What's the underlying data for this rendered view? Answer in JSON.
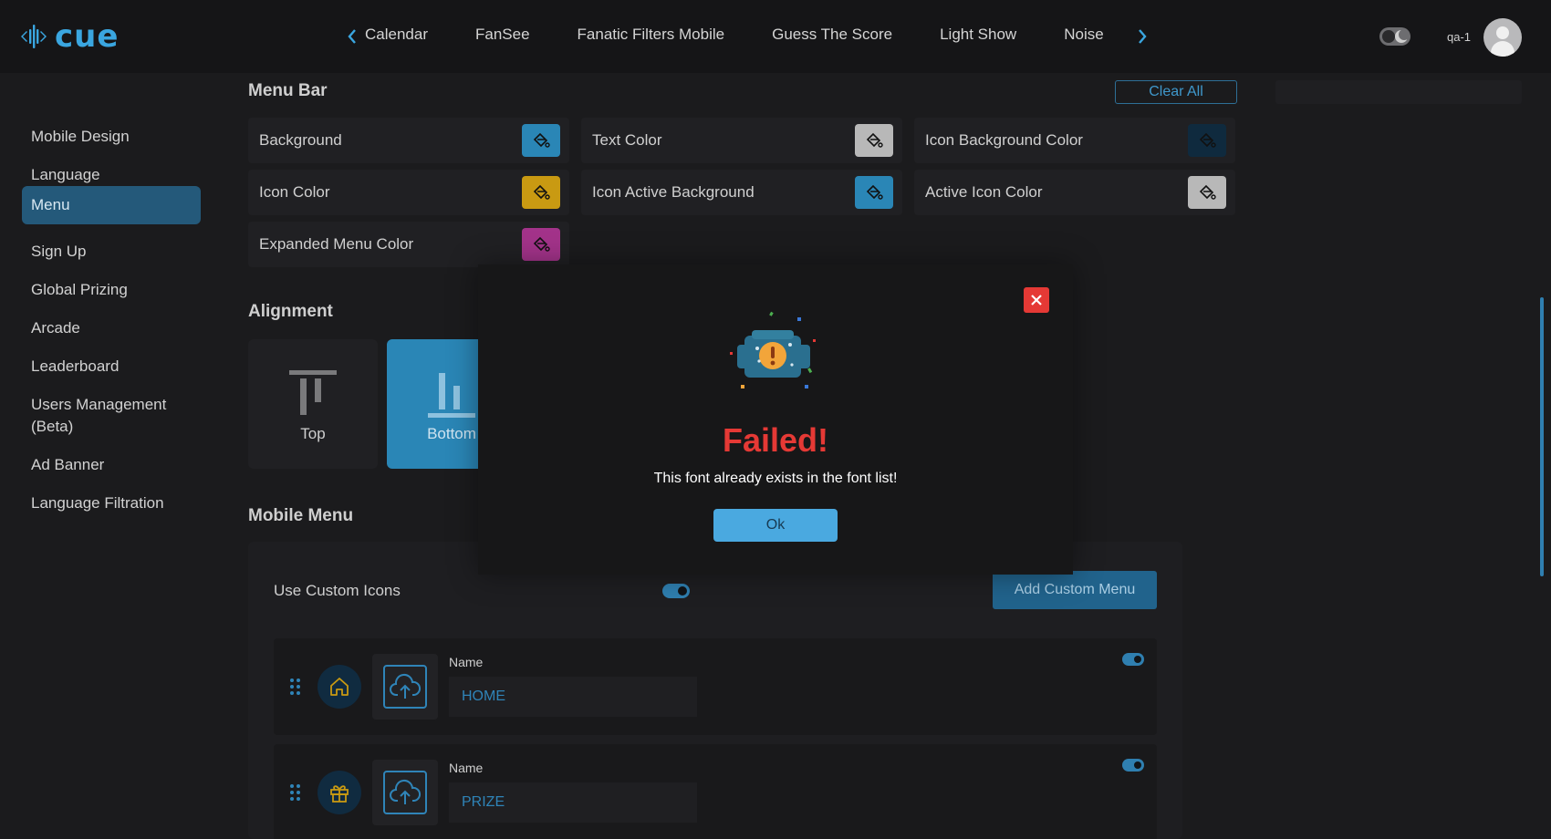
{
  "header": {
    "logo_text": "cue",
    "tabs": [
      "Calendar",
      "FanSee",
      "Fanatic Filters Mobile",
      "Guess The Score",
      "Light Show",
      "Noise"
    ],
    "username": "qa-1"
  },
  "sidebar": {
    "items": [
      {
        "label": "Mobile Design"
      },
      {
        "label": "Language"
      },
      {
        "label": "Menu",
        "active": true
      },
      {
        "label": "Sign Up"
      },
      {
        "label": "Global Prizing"
      },
      {
        "label": "Arcade"
      },
      {
        "label": "Leaderboard"
      },
      {
        "label": "Users Management (Beta)"
      },
      {
        "label": "Ad Banner"
      },
      {
        "label": "Language Filtration"
      }
    ]
  },
  "menu_bar": {
    "title": "Menu Bar",
    "clear_all": "Clear All",
    "colors": [
      {
        "label": "Background",
        "color": "#2a86b6"
      },
      {
        "label": "Text Color",
        "color": "#b8b8b8"
      },
      {
        "label": "Icon Background Color",
        "color": "#0f2a3e"
      },
      {
        "label": "Icon Color",
        "color": "#c99a12"
      },
      {
        "label": "Icon Active Background",
        "color": "#2a86b6"
      },
      {
        "label": "Active Icon Color",
        "color": "#b8b8b8"
      },
      {
        "label": "Expanded Menu Color",
        "color": "#a3338a"
      }
    ]
  },
  "alignment": {
    "title": "Alignment",
    "options": [
      "Top",
      "Bottom"
    ],
    "selected": "Bottom"
  },
  "mobile_menu": {
    "title": "Mobile Menu",
    "use_custom_icons_label": "Use Custom Icons",
    "add_custom_menu": "Add Custom Menu",
    "items": [
      {
        "name_label": "Name",
        "value": "HOME",
        "icon": "home-icon"
      },
      {
        "name_label": "Name",
        "value": "PRIZE",
        "icon": "gift-icon"
      }
    ]
  },
  "modal": {
    "title": "Failed!",
    "message": "This font already exists in the font list!",
    "ok_label": "Ok"
  },
  "colors": {
    "accent": "#3aa6e0",
    "error": "#e53935"
  }
}
